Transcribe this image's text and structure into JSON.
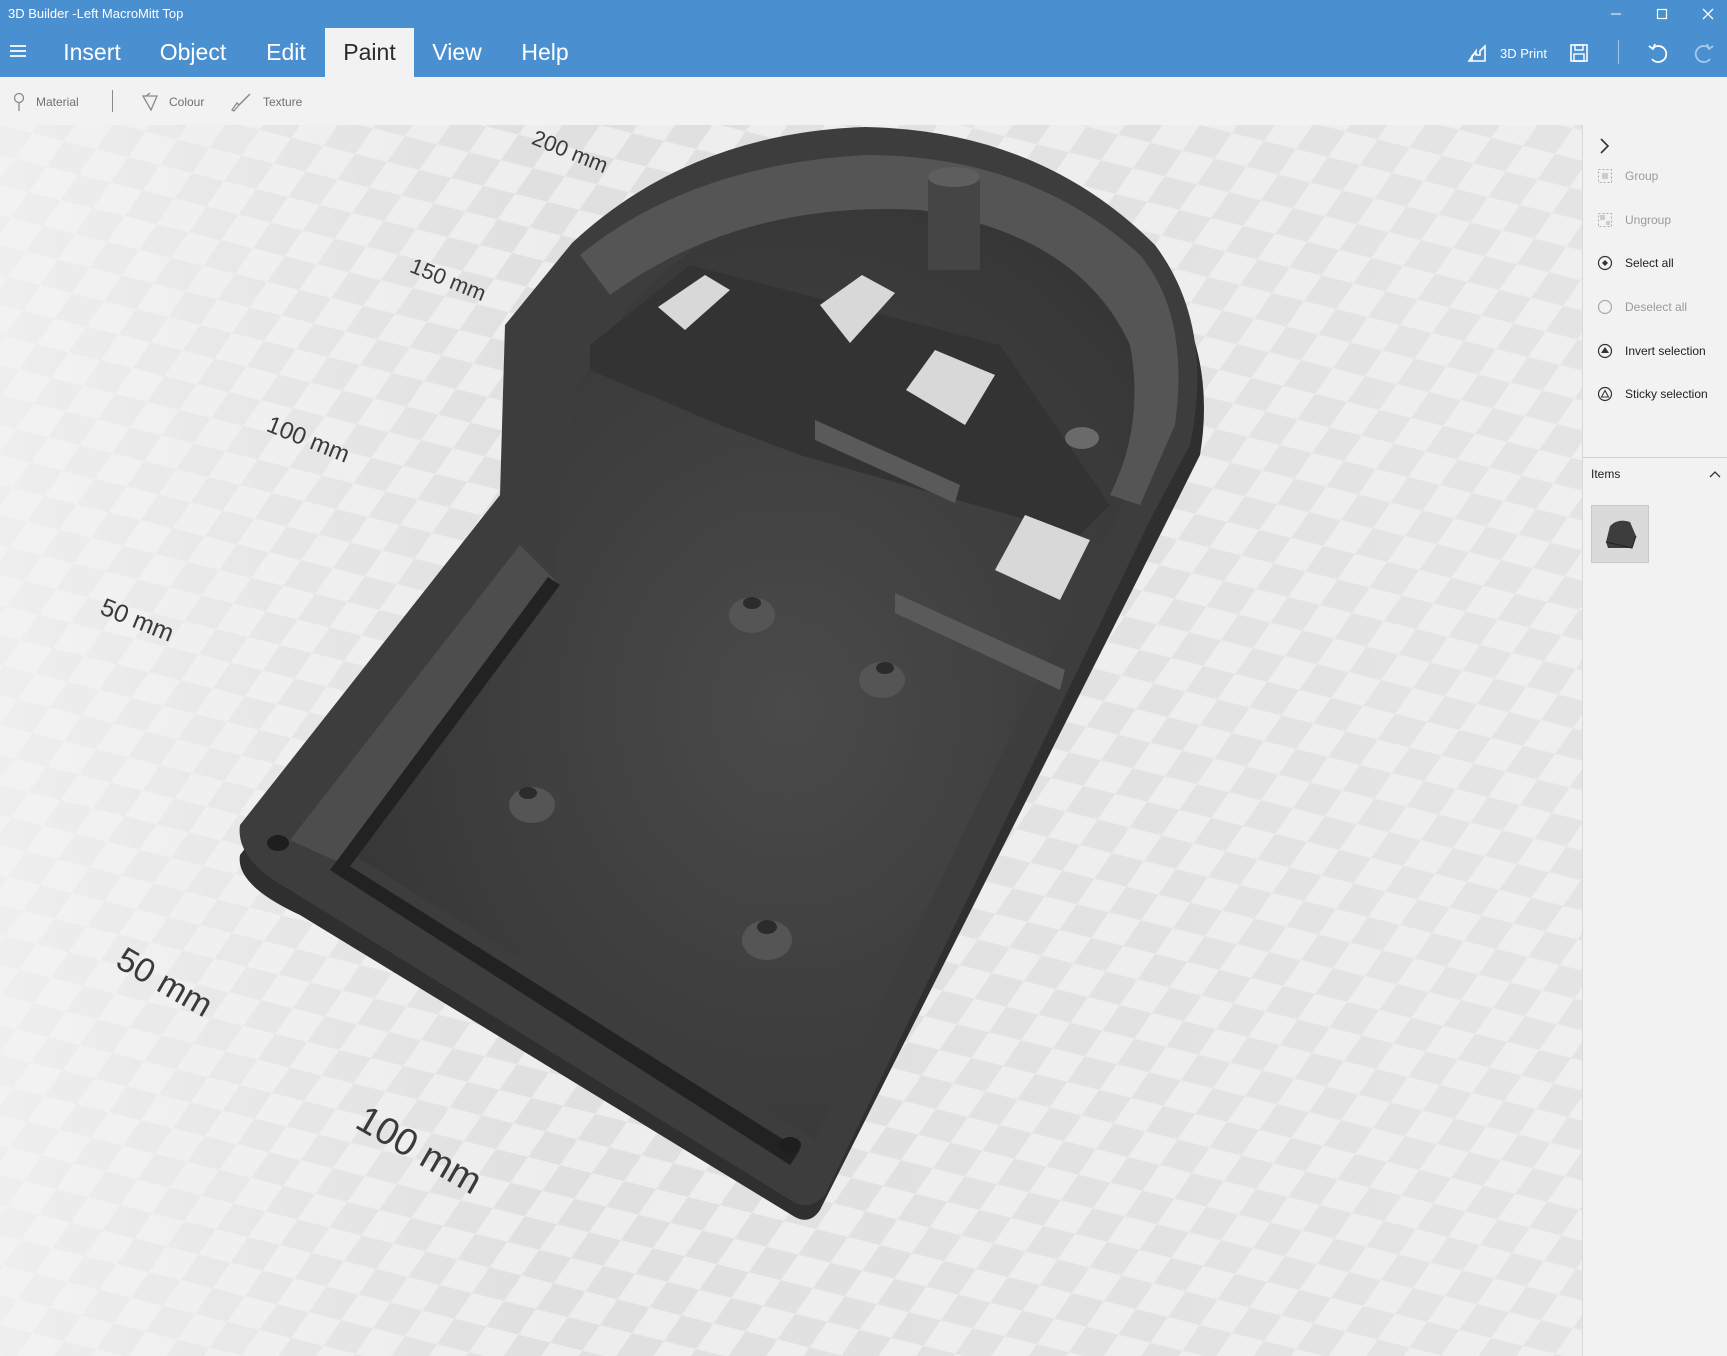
{
  "window": {
    "title": "3D Builder -Left MacroMitt Top"
  },
  "ribbon": {
    "tabs": [
      {
        "label": "Insert"
      },
      {
        "label": "Object"
      },
      {
        "label": "Edit"
      },
      {
        "label": "Paint"
      },
      {
        "label": "View"
      },
      {
        "label": "Help"
      }
    ],
    "active_tab": "Paint",
    "print_label": "3D Print"
  },
  "toolbar": {
    "material": "Material",
    "colour": "Colour",
    "texture": "Texture"
  },
  "panel": {
    "group": "Group",
    "ungroup": "Ungroup",
    "select_all": "Select all",
    "deselect_all": "Deselect all",
    "invert_selection": "Invert selection",
    "sticky_selection": "Sticky selection",
    "items_header": "Items"
  },
  "ruler": {
    "left": [
      "200 mm",
      "150 mm",
      "100 mm",
      "50 mm"
    ],
    "bottom": [
      "50 mm",
      "100 mm"
    ]
  },
  "colors": {
    "accent": "#4a8fd0",
    "model": "#3e3e3e",
    "panel_bg": "#f2f2f2"
  }
}
